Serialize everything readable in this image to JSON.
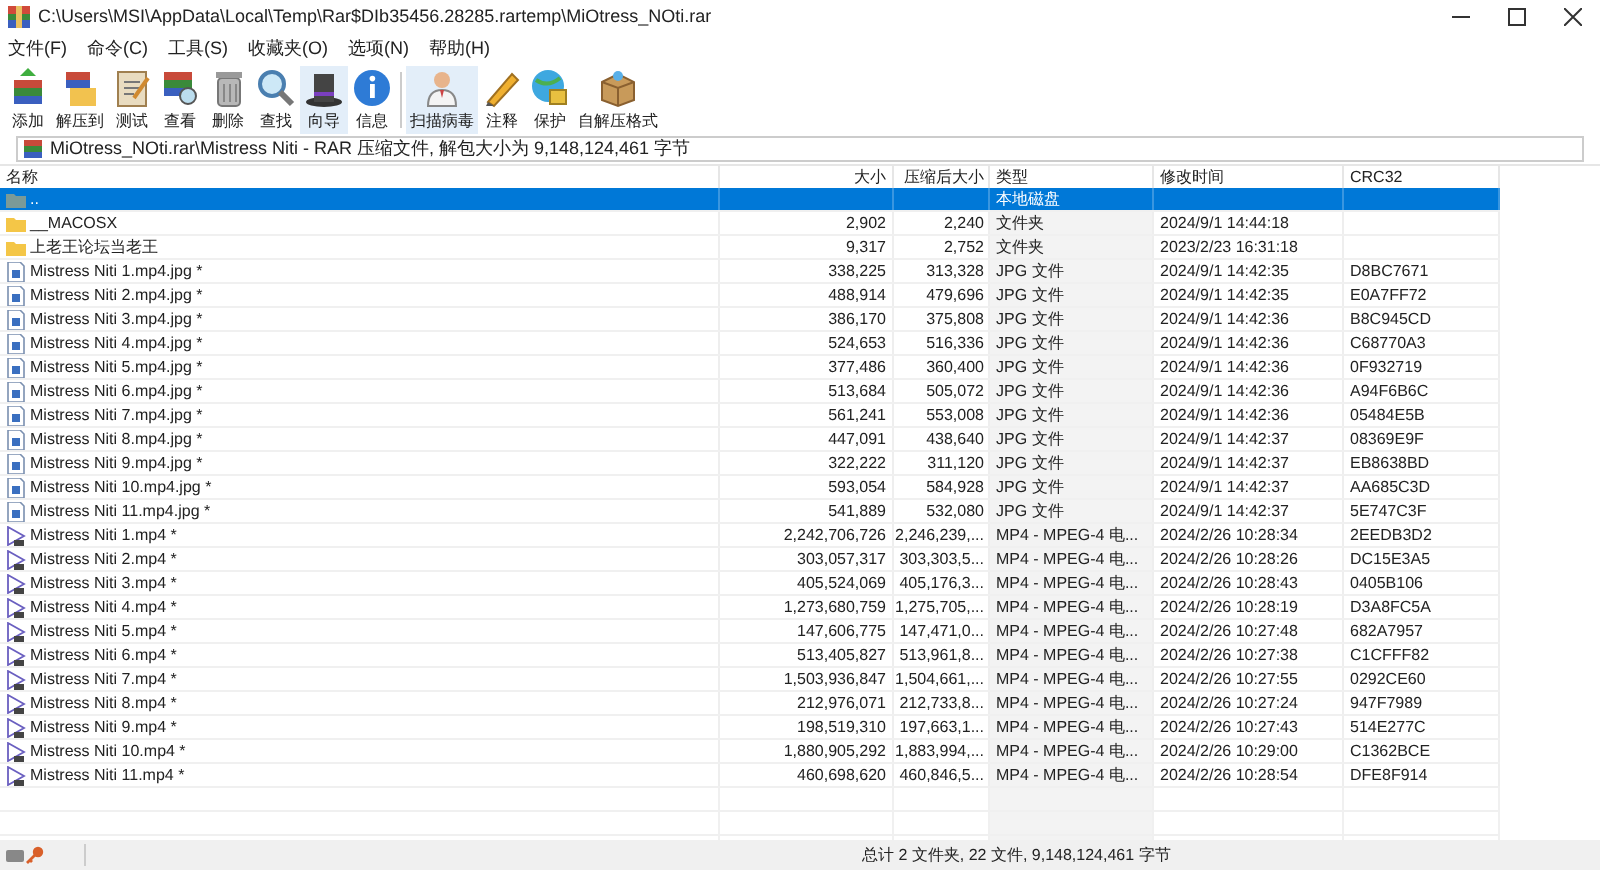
{
  "window": {
    "title": "C:\\Users\\MSI\\AppData\\Local\\Temp\\Rar$DIb35456.28285.rartemp\\MiOtress_NOti.rar"
  },
  "menu": [
    "文件(F)",
    "命令(C)",
    "工具(S)",
    "收藏夹(O)",
    "选项(N)",
    "帮助(H)"
  ],
  "toolbar": [
    {
      "label": "添加",
      "highlighted": false
    },
    {
      "label": "解压到",
      "highlighted": false
    },
    {
      "label": "测试",
      "highlighted": false
    },
    {
      "label": "查看",
      "highlighted": false
    },
    {
      "label": "删除",
      "highlighted": false
    },
    {
      "label": "查找",
      "highlighted": false
    },
    {
      "label": "向导",
      "highlighted": true
    },
    {
      "label": "信息",
      "highlighted": false
    },
    {
      "label": "扫描病毒",
      "highlighted": true
    },
    {
      "label": "注释",
      "highlighted": false
    },
    {
      "label": "保护",
      "highlighted": false
    },
    {
      "label": "自解压格式",
      "highlighted": false
    }
  ],
  "address": "MiOtress_NOti.rar\\Mistress Niti - RAR 压缩文件, 解包大小为 9,148,124,461 字节",
  "columns": [
    "名称",
    "大小",
    "压缩后大小",
    "类型",
    "修改时间",
    "CRC32"
  ],
  "rows": [
    {
      "kind": "up",
      "name": "..",
      "size": "",
      "packed": "",
      "type": "本地磁盘",
      "modified": "",
      "crc": "",
      "selected": true
    },
    {
      "kind": "folder",
      "name": "__MACOSX",
      "size": "2,902",
      "packed": "2,240",
      "type": "文件夹",
      "modified": "2024/9/1 14:44:18",
      "crc": "",
      "selected": false
    },
    {
      "kind": "folder",
      "name": "上老王论坛当老王",
      "size": "9,317",
      "packed": "2,752",
      "type": "文件夹",
      "modified": "2023/2/23 16:31:18",
      "crc": "",
      "selected": false
    },
    {
      "kind": "jpg",
      "name": "Mistress Niti 1.mp4.jpg *",
      "size": "338,225",
      "packed": "313,328",
      "type": "JPG 文件",
      "modified": "2024/9/1 14:42:35",
      "crc": "D8BC7671",
      "selected": false
    },
    {
      "kind": "jpg",
      "name": "Mistress Niti 2.mp4.jpg *",
      "size": "488,914",
      "packed": "479,696",
      "type": "JPG 文件",
      "modified": "2024/9/1 14:42:35",
      "crc": "E0A7FF72",
      "selected": false
    },
    {
      "kind": "jpg",
      "name": "Mistress Niti 3.mp4.jpg *",
      "size": "386,170",
      "packed": "375,808",
      "type": "JPG 文件",
      "modified": "2024/9/1 14:42:36",
      "crc": "B8C945CD",
      "selected": false
    },
    {
      "kind": "jpg",
      "name": "Mistress Niti 4.mp4.jpg *",
      "size": "524,653",
      "packed": "516,336",
      "type": "JPG 文件",
      "modified": "2024/9/1 14:42:36",
      "crc": "C68770A3",
      "selected": false
    },
    {
      "kind": "jpg",
      "name": "Mistress Niti 5.mp4.jpg *",
      "size": "377,486",
      "packed": "360,400",
      "type": "JPG 文件",
      "modified": "2024/9/1 14:42:36",
      "crc": "0F932719",
      "selected": false
    },
    {
      "kind": "jpg",
      "name": "Mistress Niti 6.mp4.jpg *",
      "size": "513,684",
      "packed": "505,072",
      "type": "JPG 文件",
      "modified": "2024/9/1 14:42:36",
      "crc": "A94F6B6C",
      "selected": false
    },
    {
      "kind": "jpg",
      "name": "Mistress Niti 7.mp4.jpg *",
      "size": "561,241",
      "packed": "553,008",
      "type": "JPG 文件",
      "modified": "2024/9/1 14:42:36",
      "crc": "05484E5B",
      "selected": false
    },
    {
      "kind": "jpg",
      "name": "Mistress Niti 8.mp4.jpg *",
      "size": "447,091",
      "packed": "438,640",
      "type": "JPG 文件",
      "modified": "2024/9/1 14:42:37",
      "crc": "08369E9F",
      "selected": false
    },
    {
      "kind": "jpg",
      "name": "Mistress Niti 9.mp4.jpg *",
      "size": "322,222",
      "packed": "311,120",
      "type": "JPG 文件",
      "modified": "2024/9/1 14:42:37",
      "crc": "EB8638BD",
      "selected": false
    },
    {
      "kind": "jpg",
      "name": "Mistress Niti 10.mp4.jpg *",
      "size": "593,054",
      "packed": "584,928",
      "type": "JPG 文件",
      "modified": "2024/9/1 14:42:37",
      "crc": "AA685C3D",
      "selected": false
    },
    {
      "kind": "jpg",
      "name": "Mistress Niti 11.mp4.jpg *",
      "size": "541,889",
      "packed": "532,080",
      "type": "JPG 文件",
      "modified": "2024/9/1 14:42:37",
      "crc": "5E747C3F",
      "selected": false
    },
    {
      "kind": "mp4",
      "name": "Mistress Niti 1.mp4 *",
      "size": "2,242,706,726",
      "packed": "2,246,239,...",
      "type": "MP4 - MPEG-4 电...",
      "modified": "2024/2/26 10:28:34",
      "crc": "2EEDB3D2",
      "selected": false
    },
    {
      "kind": "mp4",
      "name": "Mistress Niti 2.mp4 *",
      "size": "303,057,317",
      "packed": "303,303,5...",
      "type": "MP4 - MPEG-4 电...",
      "modified": "2024/2/26 10:28:26",
      "crc": "DC15E3A5",
      "selected": false
    },
    {
      "kind": "mp4",
      "name": "Mistress Niti 3.mp4 *",
      "size": "405,524,069",
      "packed": "405,176,3...",
      "type": "MP4 - MPEG-4 电...",
      "modified": "2024/2/26 10:28:43",
      "crc": "0405B106",
      "selected": false
    },
    {
      "kind": "mp4",
      "name": "Mistress Niti 4.mp4 *",
      "size": "1,273,680,759",
      "packed": "1,275,705,...",
      "type": "MP4 - MPEG-4 电...",
      "modified": "2024/2/26 10:28:19",
      "crc": "D3A8FC5A",
      "selected": false
    },
    {
      "kind": "mp4",
      "name": "Mistress Niti 5.mp4 *",
      "size": "147,606,775",
      "packed": "147,471,0...",
      "type": "MP4 - MPEG-4 电...",
      "modified": "2024/2/26 10:27:48",
      "crc": "682A7957",
      "selected": false
    },
    {
      "kind": "mp4",
      "name": "Mistress Niti 6.mp4 *",
      "size": "513,405,827",
      "packed": "513,961,8...",
      "type": "MP4 - MPEG-4 电...",
      "modified": "2024/2/26 10:27:38",
      "crc": "C1CFFF82",
      "selected": false
    },
    {
      "kind": "mp4",
      "name": "Mistress Niti 7.mp4 *",
      "size": "1,503,936,847",
      "packed": "1,504,661,...",
      "type": "MP4 - MPEG-4 电...",
      "modified": "2024/2/26 10:27:55",
      "crc": "0292CE60",
      "selected": false
    },
    {
      "kind": "mp4",
      "name": "Mistress Niti 8.mp4 *",
      "size": "212,976,071",
      "packed": "212,733,8...",
      "type": "MP4 - MPEG-4 电...",
      "modified": "2024/2/26 10:27:24",
      "crc": "947F7989",
      "selected": false
    },
    {
      "kind": "mp4",
      "name": "Mistress Niti 9.mp4 *",
      "size": "198,519,310",
      "packed": "197,663,1...",
      "type": "MP4 - MPEG-4 电...",
      "modified": "2024/2/26 10:27:43",
      "crc": "514E277C",
      "selected": false
    },
    {
      "kind": "mp4",
      "name": "Mistress Niti 10.mp4 *",
      "size": "1,880,905,292",
      "packed": "1,883,994,...",
      "type": "MP4 - MPEG-4 电...",
      "modified": "2024/2/26 10:29:00",
      "crc": "C1362BCE",
      "selected": false
    },
    {
      "kind": "mp4",
      "name": "Mistress Niti 11.mp4 *",
      "size": "460,698,620",
      "packed": "460,846,5...",
      "type": "MP4 - MPEG-4 电...",
      "modified": "2024/2/26 10:28:54",
      "crc": "DFE8F914",
      "selected": false
    }
  ],
  "status": "总计 2 文件夹, 22 文件, 9,148,124,461 字节"
}
